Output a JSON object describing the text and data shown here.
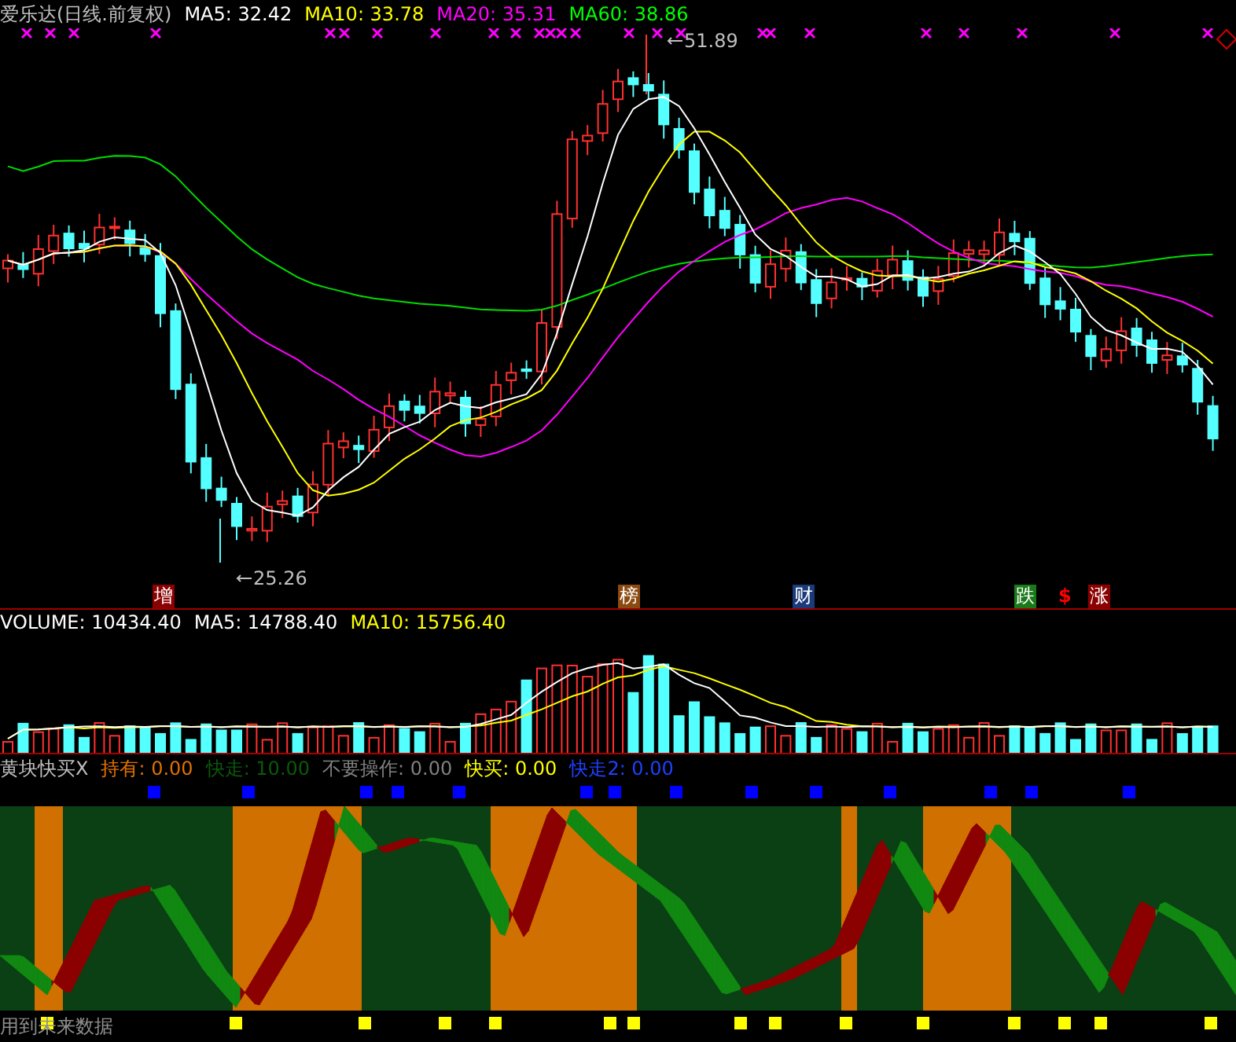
{
  "header": {
    "title": "爱乐达(日线.前复权)",
    "ma": [
      {
        "label": "MA5: 32.42",
        "color": "#ffffff"
      },
      {
        "label": "MA10: 33.78",
        "color": "#ffff00"
      },
      {
        "label": "MA20: 35.31",
        "color": "#ff00ff"
      },
      {
        "label": "MA60: 38.86",
        "color": "#00ff00"
      }
    ]
  },
  "price_labels": [
    {
      "text": "51.89"
    },
    {
      "text": "25.26"
    }
  ],
  "event_tags": [
    {
      "kind": "tag",
      "text": "增",
      "color": "#8b0000"
    },
    {
      "kind": "tag",
      "text": "榜",
      "color": "#8b4a10"
    },
    {
      "kind": "tag",
      "text": "财",
      "color": "#1a3a7a"
    },
    {
      "kind": "tag",
      "text": "跌",
      "color": "#1a7a1a"
    },
    {
      "kind": "glyph",
      "text": "$",
      "color": "#ff0000"
    },
    {
      "kind": "tag",
      "text": "涨",
      "color": "#8b0000"
    }
  ],
  "volume_header": [
    {
      "label": "VOLUME: 10434.40",
      "color": "#ffffff"
    },
    {
      "label": "MA5: 14788.40",
      "color": "#ffffff"
    },
    {
      "label": "MA10: 15756.40",
      "color": "#ffff00"
    }
  ],
  "indicator": {
    "name": "黄块快买X",
    "values": [
      {
        "label": "持有: 0.00",
        "color": "#e07000"
      },
      {
        "label": "快走: 10.00",
        "color": "#0a5a0a"
      },
      {
        "label": "不要操作: 0.00",
        "color": "#808080"
      },
      {
        "label": "快买: 0.00",
        "color": "#ffff00"
      },
      {
        "label": "快走2: 0.00",
        "color": "#2040ff"
      }
    ]
  },
  "warning": "用到未来数据"
}
